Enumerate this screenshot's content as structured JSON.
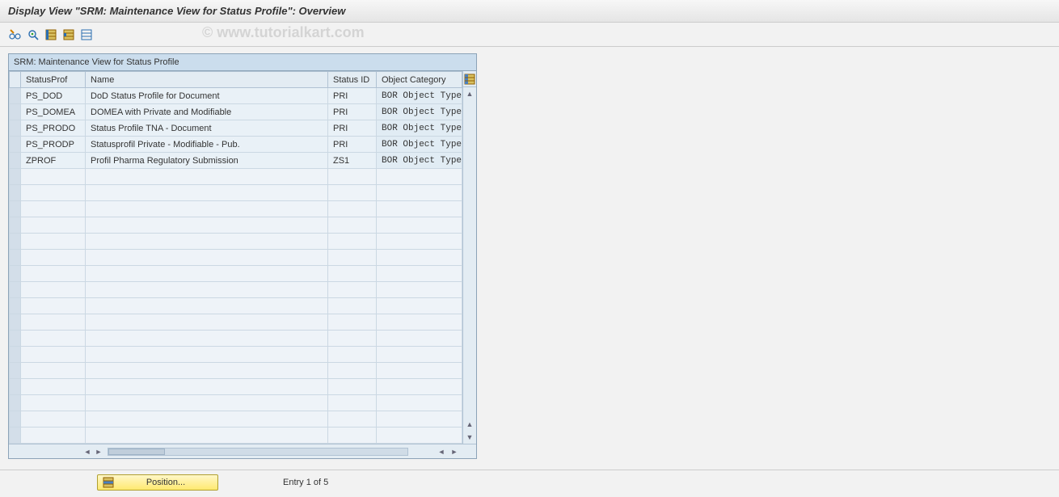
{
  "title": "Display View \"SRM: Maintenance View for Status Profile\": Overview",
  "watermark": "© www.tutorialkart.com",
  "table": {
    "caption": "SRM: Maintenance View for Status Profile",
    "columns": {
      "status_prof": "StatusProf",
      "name": "Name",
      "status_id": "Status ID",
      "object_category": "Object Category"
    },
    "rows": [
      {
        "status_prof": "PS_DOD",
        "name": "DoD Status Profile for Document",
        "status_id": "PRI",
        "object_category": "BOR Object Type"
      },
      {
        "status_prof": "PS_DOMEA",
        "name": "DOMEA with Private and Modifiable",
        "status_id": "PRI",
        "object_category": "BOR Object Type"
      },
      {
        "status_prof": "PS_PRODO",
        "name": "Status Profile TNA - Document",
        "status_id": "PRI",
        "object_category": "BOR Object Type"
      },
      {
        "status_prof": "PS_PRODP",
        "name": "Statusprofil Private - Modifiable - Pub.",
        "status_id": "PRI",
        "object_category": "BOR Object Type"
      },
      {
        "status_prof": "ZPROF",
        "name": "Profil Pharma Regulatory Submission",
        "status_id": "ZS1",
        "object_category": "BOR Object Type"
      }
    ],
    "empty_rows": 17
  },
  "footer": {
    "position_label": "Position...",
    "entry_text": "Entry 1 of 5"
  }
}
